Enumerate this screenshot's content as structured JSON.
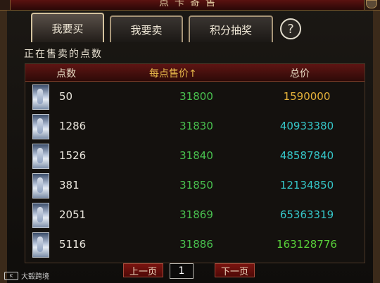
{
  "window": {
    "title": "点卡寄售"
  },
  "tabs": [
    {
      "label": "我要买",
      "active": true
    },
    {
      "label": "我要卖",
      "active": false
    },
    {
      "label": "积分抽奖",
      "active": false
    }
  ],
  "help_symbol": "?",
  "section_label": "正在售卖的点数",
  "table": {
    "headers": {
      "amount": "点数",
      "price": "每点售价↑",
      "total": "总价"
    },
    "rows": [
      {
        "amount": "50",
        "price": "31800",
        "total": "1590000",
        "total_color": "yellow"
      },
      {
        "amount": "1286",
        "price": "31830",
        "total": "40933380",
        "total_color": "cyan"
      },
      {
        "amount": "1526",
        "price": "31840",
        "total": "48587840",
        "total_color": "cyan"
      },
      {
        "amount": "381",
        "price": "31850",
        "total": "12134850",
        "total_color": "cyan"
      },
      {
        "amount": "2051",
        "price": "31869",
        "total": "65363319",
        "total_color": "cyan"
      },
      {
        "amount": "5116",
        "price": "31886",
        "total": "163128776",
        "total_color": "green"
      }
    ]
  },
  "pager": {
    "prev_label": "上一页",
    "page": "1",
    "next_label": "下一页"
  },
  "watermark": {
    "logo": "K",
    "text": "大毂跨境"
  },
  "colors": {
    "accent_red": "#6b120e",
    "price_green": "#49c14f",
    "total_cyan": "#35c6c8",
    "total_yellow": "#e6b23a",
    "total_green": "#59d13a"
  }
}
